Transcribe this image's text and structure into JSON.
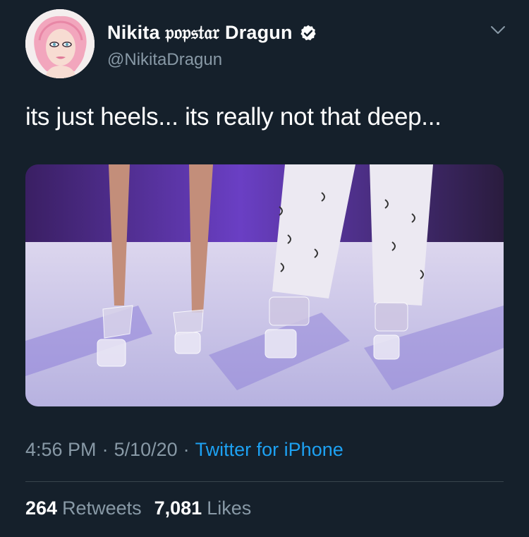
{
  "author": {
    "display_name": "Nikita 𝔭𝔬𝔭𝔰𝔱𝔞𝔯 Dragun",
    "handle": "@NikitaDragun",
    "avatar_icon": "avatar-illustration",
    "verified_icon": "verified-badge-icon"
  },
  "tweet": {
    "text": "its just heels... its really not that deep..."
  },
  "meta": {
    "time": "4:56 PM",
    "date": "5/10/20",
    "separator": "·",
    "source": "Twitter for iPhone"
  },
  "stats": {
    "retweets_count": "264",
    "retweets_label": "Retweets",
    "likes_count": "7,081",
    "likes_label": "Likes"
  },
  "colors": {
    "background": "#15202b",
    "secondary_text": "#8899a6",
    "accent": "#1da1f2",
    "divider": "#38444d"
  }
}
